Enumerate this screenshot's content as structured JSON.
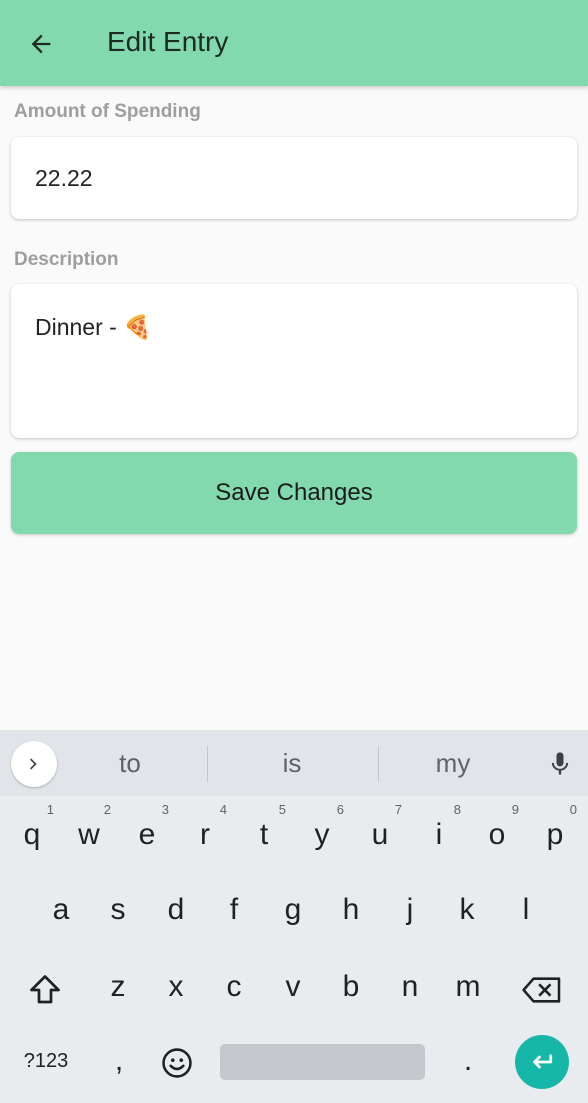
{
  "app_bar": {
    "title": "Edit Entry"
  },
  "form": {
    "amount_label": "Amount of Spending",
    "amount_value": "22.22",
    "description_label": "Description",
    "description_value": "Dinner - 🍕",
    "save_label": "Save Changes"
  },
  "keyboard": {
    "suggestions": [
      "to",
      "is",
      "my"
    ],
    "row1": [
      {
        "key": "q",
        "num": "1"
      },
      {
        "key": "w",
        "num": "2"
      },
      {
        "key": "e",
        "num": "3"
      },
      {
        "key": "r",
        "num": "4"
      },
      {
        "key": "t",
        "num": "5"
      },
      {
        "key": "y",
        "num": "6"
      },
      {
        "key": "u",
        "num": "7"
      },
      {
        "key": "i",
        "num": "8"
      },
      {
        "key": "o",
        "num": "9"
      },
      {
        "key": "p",
        "num": "0"
      }
    ],
    "row2": [
      "a",
      "s",
      "d",
      "f",
      "g",
      "h",
      "j",
      "k",
      "l"
    ],
    "row3": [
      "z",
      "x",
      "c",
      "v",
      "b",
      "n",
      "m"
    ],
    "symbols_key": "?123",
    "comma_key": ",",
    "period_key": "."
  },
  "colors": {
    "accent": "#82d9ae",
    "enter": "#16b7a8"
  }
}
